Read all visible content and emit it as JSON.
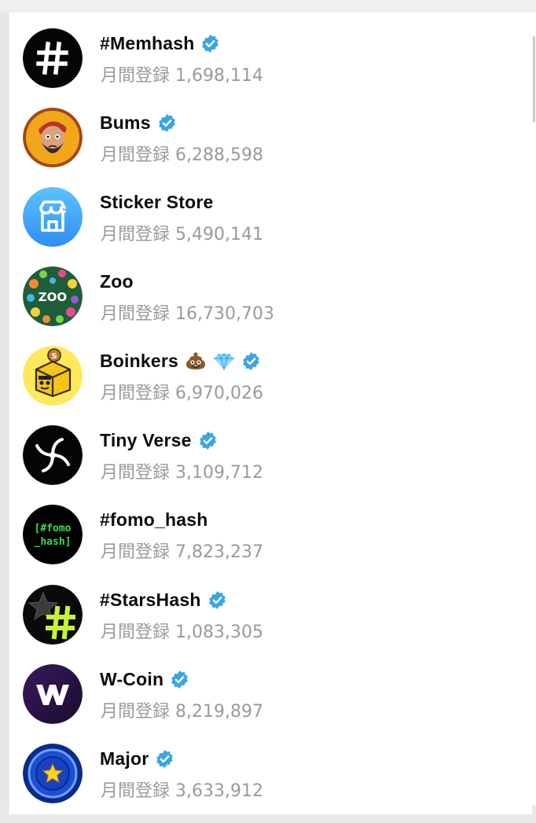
{
  "header": {
    "partial_label": ""
  },
  "list": {
    "items": [
      {
        "name": "#Memhash",
        "verified": true,
        "stat_label": "月間登録",
        "stat_value": "1,698,114",
        "avatar_icon": "hash-logo-icon"
      },
      {
        "name": "Bums",
        "verified": true,
        "stat_label": "月間登録",
        "stat_value": "6,288,598",
        "avatar_icon": "bearded-man-logo-icon"
      },
      {
        "name": "Sticker Store",
        "verified": false,
        "stat_label": "月間登録",
        "stat_value": "5,490,141",
        "avatar_icon": "storefront-logo-icon"
      },
      {
        "name": "Zoo",
        "verified": false,
        "stat_label": "月間登録",
        "stat_value": "16,730,703",
        "avatar_icon": "zoo-animals-logo-icon"
      },
      {
        "name": "Boinkers",
        "verified": true,
        "emojis": [
          "poop-emoji",
          "gem-emoji"
        ],
        "stat_label": "月間登録",
        "stat_value": "6,970,026",
        "avatar_icon": "boinkers-box-logo-icon"
      },
      {
        "name": "Tiny Verse",
        "verified": true,
        "stat_label": "月間登録",
        "stat_value": "3,109,712",
        "avatar_icon": "swirl-logo-icon"
      },
      {
        "name": "#fomo_hash",
        "verified": false,
        "stat_label": "月間登録",
        "stat_value": "7,823,237",
        "avatar_icon": "fomo-hash-logo-icon",
        "avatar_text": "[#fomo\n_hash]"
      },
      {
        "name": "#StarsHash",
        "verified": true,
        "stat_label": "月間登録",
        "stat_value": "1,083,305",
        "avatar_icon": "star-hash-logo-icon"
      },
      {
        "name": "W-Coin",
        "verified": true,
        "stat_label": "月間登録",
        "stat_value": "8,219,897",
        "avatar_icon": "w-letter-logo-icon"
      },
      {
        "name": "Major",
        "verified": true,
        "stat_label": "月間登録",
        "stat_value": "3,633,912",
        "avatar_icon": "star-coin-logo-icon"
      }
    ]
  },
  "colors": {
    "verified_badge": "#3aa4e8",
    "stat_text": "#9a9a9a",
    "name_text": "#0c0c0c"
  }
}
